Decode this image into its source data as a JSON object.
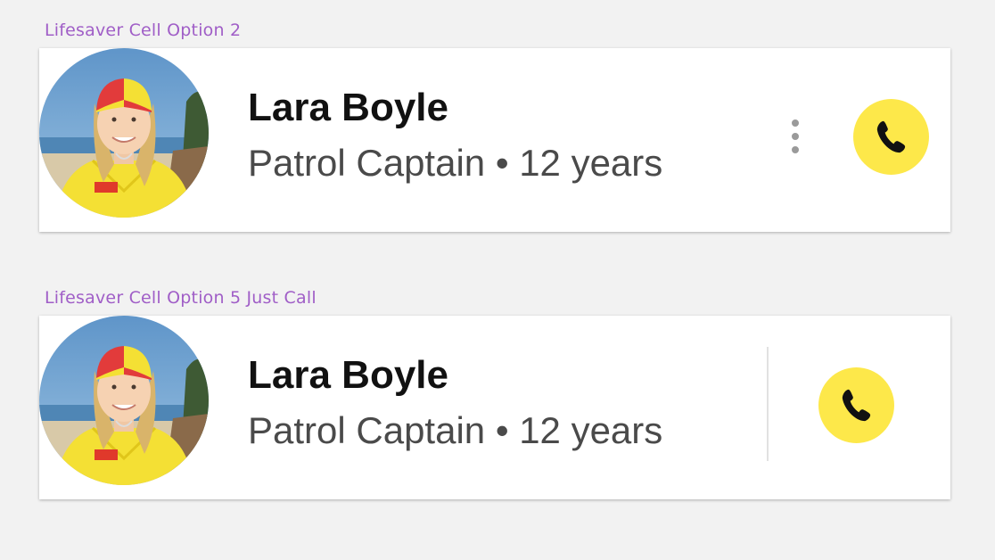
{
  "cell_option_2": {
    "caption": "Lifesaver Cell Option 2",
    "name": "Lara Boyle",
    "role": "Patrol Captain",
    "separator": "•",
    "tenure": "12 years",
    "subtitle": "Patrol Captain • 12 years",
    "avatar_icon": "avatar-photo",
    "more_icon": "more-vertical-icon",
    "call_icon": "phone-icon"
  },
  "cell_option_5": {
    "caption": "Lifesaver Cell Option 5 Just Call",
    "name": "Lara Boyle",
    "role": "Patrol Captain",
    "separator": "•",
    "tenure": "12 years",
    "subtitle": "Patrol Captain • 12 years",
    "avatar_icon": "avatar-photo",
    "call_icon": "phone-icon"
  },
  "colors": {
    "background": "#f2f2f2",
    "caption": "#a05ec7",
    "card": "#ffffff",
    "call_button": "#fde84a",
    "name_text": "#111111",
    "subtitle_text": "#4a4a4a",
    "more_dots": "#9a9a9a"
  }
}
